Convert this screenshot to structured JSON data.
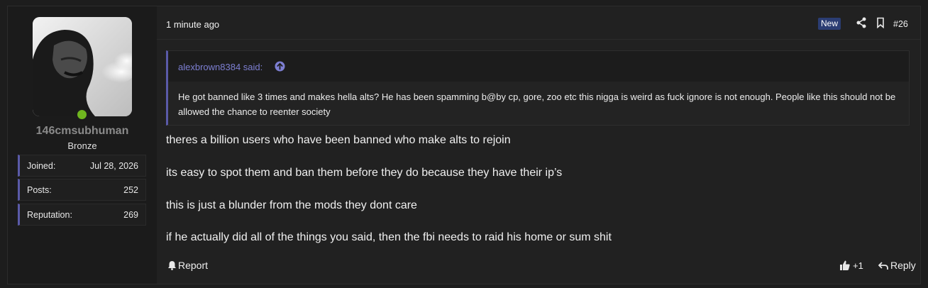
{
  "user": {
    "username": "146cmsubhuman",
    "rank": "Bronze",
    "stats": [
      {
        "label": "Joined:",
        "value": "Jul 28, 2026"
      },
      {
        "label": "Posts:",
        "value": "252"
      },
      {
        "label": "Reputation:",
        "value": "269"
      }
    ]
  },
  "post": {
    "time": "1 minute ago",
    "badge": "New",
    "number": "#26",
    "quote": {
      "author": "alexbrown8384 said:",
      "text": "He got banned like 3 times and makes hella alts? He has been spamming b@by cp, gore, zoo etc this nigga is weird as fuck ignore is not enough. People like this should not be allowed the chance to reenter society"
    },
    "lines": [
      "theres a billion users who have been banned who make alts to rejoin",
      "its easy to spot them and ban them before they do because they have their ip’s",
      "this is just a blunder from the mods they dont care",
      "if he actually did all of the things you said, then the fbi needs to raid his home or sum shit"
    ]
  },
  "actions": {
    "report": "Report",
    "like_count": "+1",
    "reply": "Reply"
  },
  "colors": {
    "accent": "#5a5aa8",
    "quote_author": "#7d7fd2",
    "online": "#6fb51f",
    "badge": "#2b3d73"
  }
}
